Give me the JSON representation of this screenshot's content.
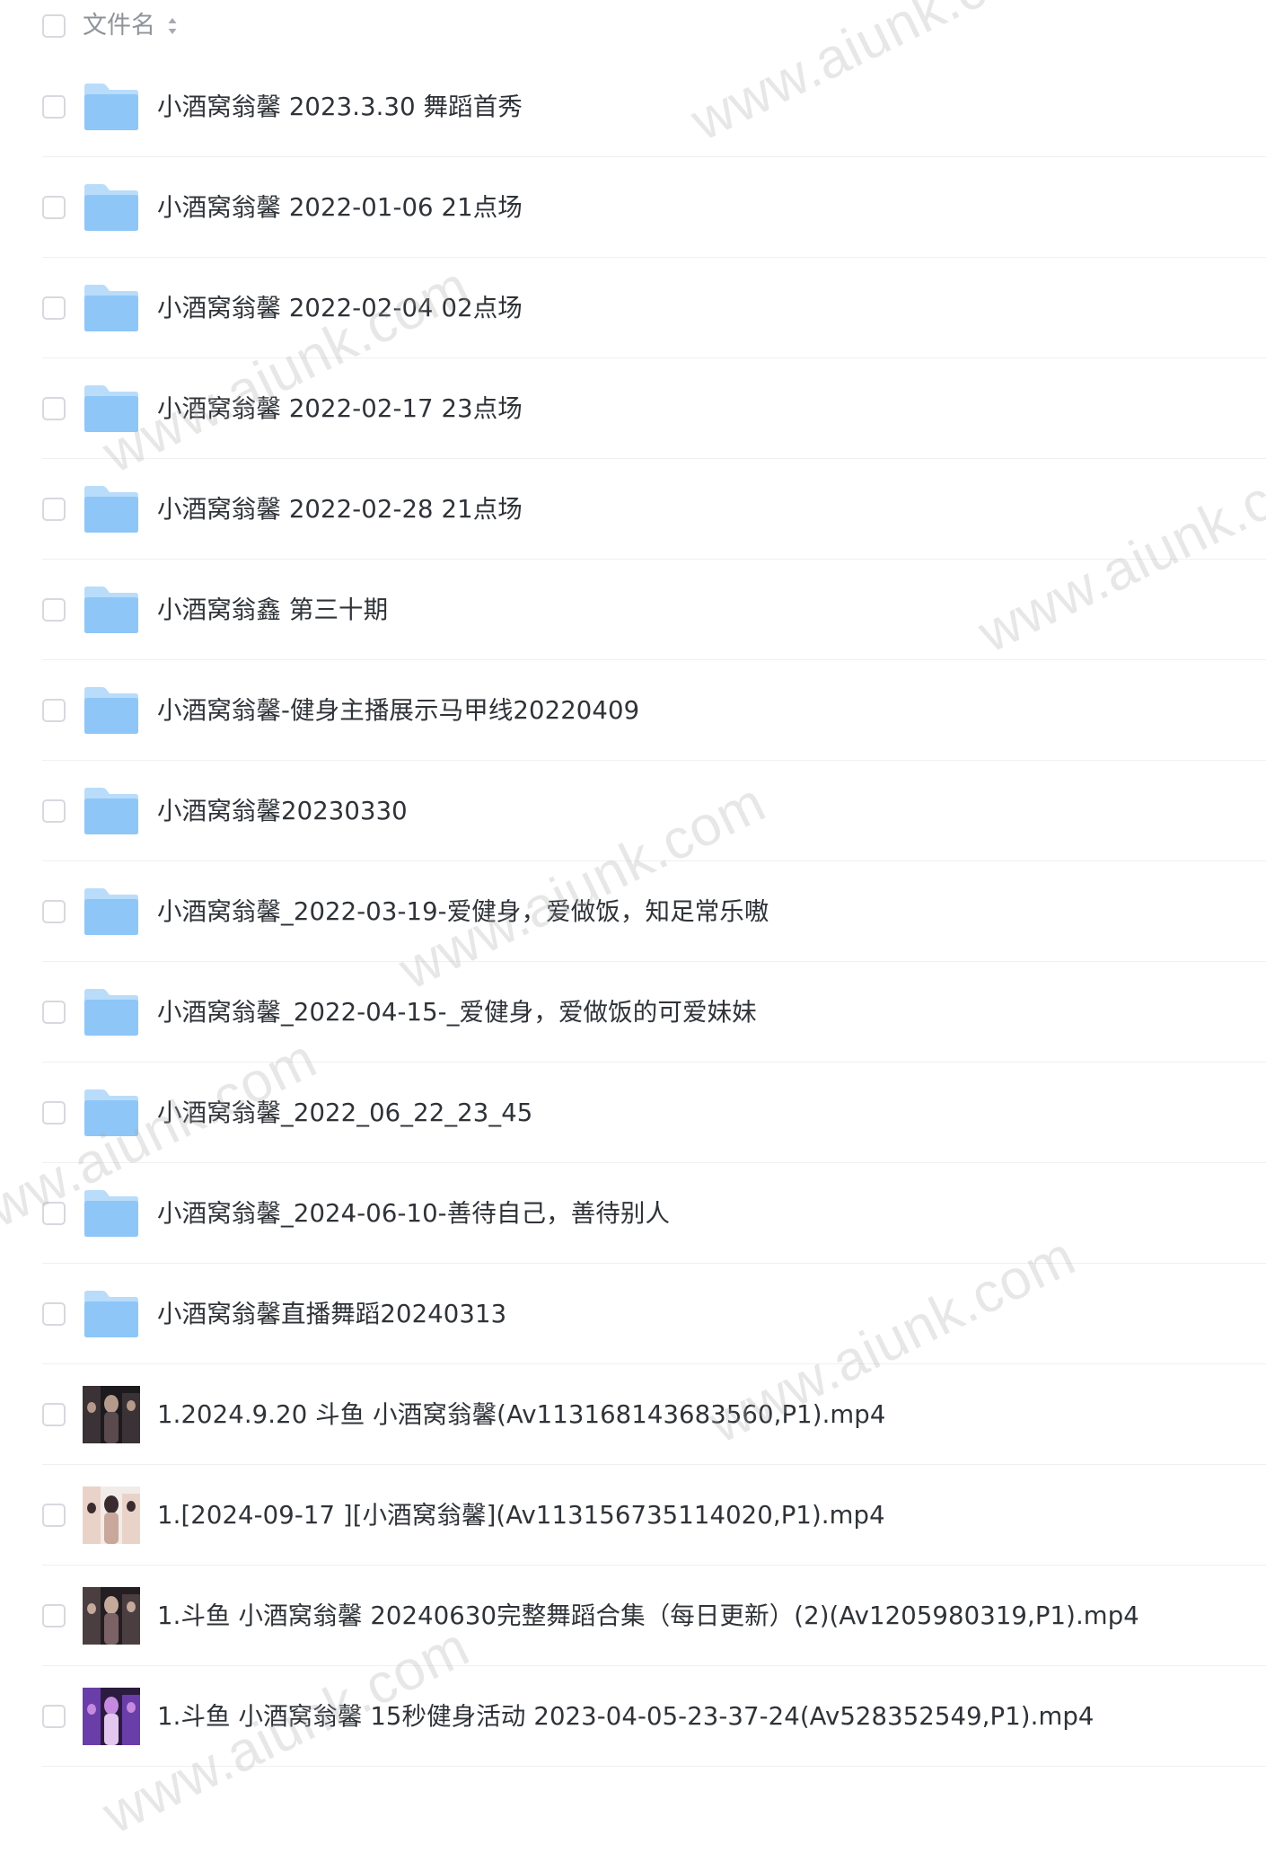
{
  "header": {
    "column_label": "文件名",
    "sort_icon": "sort-updown-icon"
  },
  "files": [
    {
      "type": "folder",
      "icon": "folder-icon",
      "name": "小酒窝翁馨 2023.3.30 舞蹈首秀"
    },
    {
      "type": "folder",
      "icon": "folder-icon",
      "name": "小酒窝翁馨 2022-01-06 21点场"
    },
    {
      "type": "folder",
      "icon": "folder-icon",
      "name": "小酒窝翁馨 2022-02-04 02点场"
    },
    {
      "type": "folder",
      "icon": "folder-icon",
      "name": "小酒窝翁馨 2022-02-17 23点场"
    },
    {
      "type": "folder",
      "icon": "folder-icon",
      "name": "小酒窝翁馨 2022-02-28 21点场"
    },
    {
      "type": "folder",
      "icon": "folder-icon",
      "name": "小酒窝翁鑫 第三十期"
    },
    {
      "type": "folder",
      "icon": "folder-icon",
      "name": "小酒窝翁馨-健身主播展示马甲线20220409"
    },
    {
      "type": "folder",
      "icon": "folder-icon",
      "name": "小酒窝翁馨20230330"
    },
    {
      "type": "folder",
      "icon": "folder-icon",
      "name": "小酒窝翁馨_2022-03-19-爱健身，爱做饭，知足常乐嗷"
    },
    {
      "type": "folder",
      "icon": "folder-icon",
      "name": "小酒窝翁馨_2022-04-15-_爱健身，爱做饭的可爱妹妹"
    },
    {
      "type": "folder",
      "icon": "folder-icon",
      "name": "小酒窝翁馨_2022_06_22_23_45"
    },
    {
      "type": "folder",
      "icon": "folder-icon",
      "name": "小酒窝翁馨_2024-06-10-善待自己，善待别人"
    },
    {
      "type": "folder",
      "icon": "folder-icon",
      "name": "小酒窝翁馨直播舞蹈20240313"
    },
    {
      "type": "video",
      "icon": "video-thumbnail",
      "name": "1.2024.9.20 斗鱼 小酒窝翁馨(Av113168143683560,P1).mp4"
    },
    {
      "type": "video",
      "icon": "video-thumbnail",
      "name": "1.[2024-09-17 ][小酒窝翁馨](Av113156735114020,P1).mp4"
    },
    {
      "type": "video",
      "icon": "video-thumbnail",
      "name": "1.斗鱼 小酒窝翁馨 20240630完整舞蹈合集（每日更新）(2)(Av1205980319,P1).mp4"
    },
    {
      "type": "video",
      "icon": "video-thumbnail",
      "name": "1.斗鱼 小酒窝翁馨 15秒健身活动 2023-04-05-23-37-24(Av528352549,P1).mp4"
    }
  ],
  "watermark": "www.aiunk.com",
  "colors": {
    "folder_light": "#b9dcfb",
    "folder_main": "#8ec6f7",
    "text": "#2f3338",
    "header_text": "#8f949b",
    "divider": "#eef0f2",
    "checkbox_border": "#d6d9de"
  }
}
